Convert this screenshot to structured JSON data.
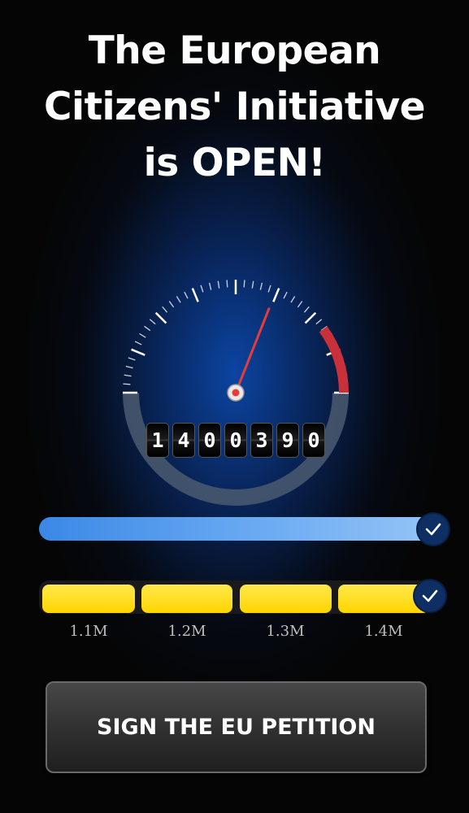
{
  "headline": {
    "line1": "The European",
    "line2": "Citizens' Initiative",
    "line3": "is OPEN!"
  },
  "gauge": {
    "needle_level": 0.62,
    "red_zone_start": 0.8,
    "colors": {
      "needle": "#e83b3b",
      "red_zone": "#c8303a",
      "arc": "#4a5a70",
      "tick": "#ffffff"
    }
  },
  "counter": {
    "value": "1400390",
    "digits": [
      "1",
      "4",
      "0",
      "0",
      "3",
      "9",
      "0"
    ]
  },
  "progress": {
    "fill_fraction": 1.0,
    "check_icon": "check-icon"
  },
  "milestones": {
    "labels": [
      "1.1M",
      "1.2M",
      "1.3M",
      "1.4M"
    ],
    "completed_fraction": 1.0,
    "color": "#ffdd1a",
    "check_icon": "check-icon"
  },
  "cta": {
    "label": "SIGN THE EU PETITION"
  }
}
